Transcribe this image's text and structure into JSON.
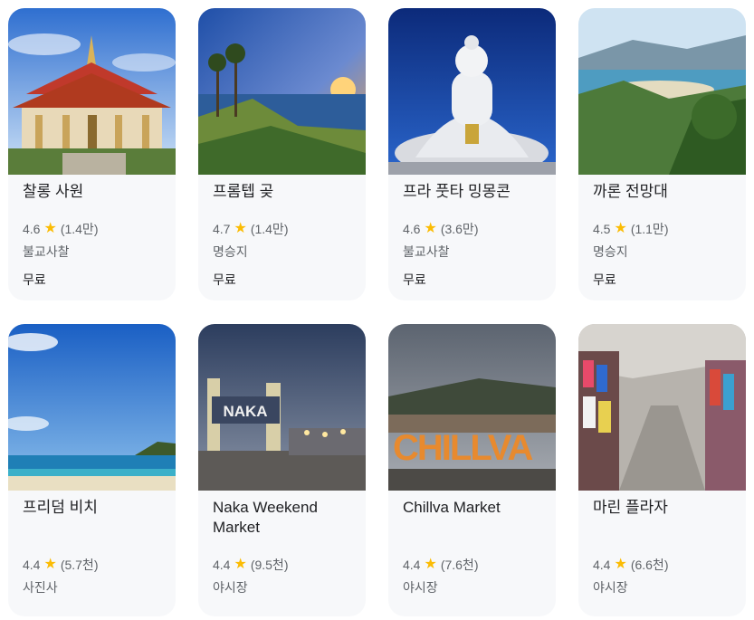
{
  "places": [
    {
      "name": "찰롱 사원",
      "rating": "4.6",
      "reviews": "(1.4만)",
      "category": "불교사찰",
      "price": "무료",
      "image": "temple-photo"
    },
    {
      "name": "프롬텝 곶",
      "rating": "4.7",
      "reviews": "(1.4만)",
      "category": "명승지",
      "price": "무료",
      "image": "cape-sunset-photo"
    },
    {
      "name": "프라 풋타 밍몽콘",
      "rating": "4.6",
      "reviews": "(3.6만)",
      "category": "불교사찰",
      "price": "무료",
      "image": "big-buddha-photo"
    },
    {
      "name": "까론 전망대",
      "rating": "4.5",
      "reviews": "(1.1만)",
      "category": "명승지",
      "price": "무료",
      "image": "viewpoint-photo"
    },
    {
      "name": "프리덤 비치",
      "rating": "4.4",
      "reviews": "(5.7천)",
      "category": "사진사",
      "image": "beach-photo"
    },
    {
      "name": "Naka Weekend Market",
      "rating": "4.4",
      "reviews": "(9.5천)",
      "category": "야시장",
      "image": "naka-market-photo"
    },
    {
      "name": "Chillva Market",
      "rating": "4.4",
      "reviews": "(7.6천)",
      "category": "야시장",
      "image": "chillva-market-photo"
    },
    {
      "name": "마린 플라자",
      "rating": "4.4",
      "reviews": "(6.6천)",
      "category": "야시장",
      "image": "market-stalls-photo"
    }
  ],
  "star_icon": "star-icon",
  "colors": {
    "star": "#fbbc04",
    "card_bg": "#f7f8fa",
    "text": "#202124",
    "muted": "#5f6368"
  }
}
